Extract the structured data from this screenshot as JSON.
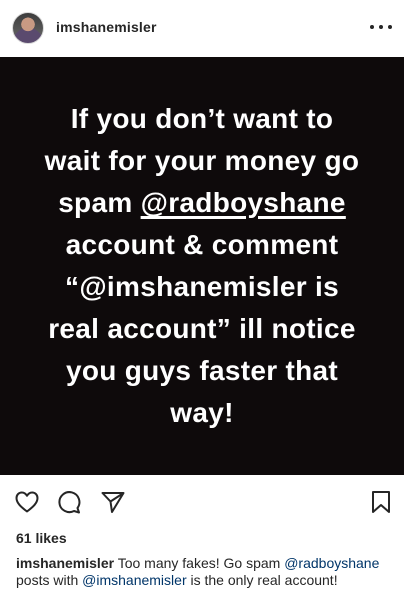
{
  "header": {
    "username": "imshanemisler"
  },
  "media": {
    "line1": "If you don’t want to",
    "line2": "wait for your money go",
    "line3_pre": "spam ",
    "line3_link": "@radboyshane",
    "line4": "account & comment",
    "line5": "“@imshanemisler is",
    "line6": "real account” ill notice",
    "line7": "you guys faster that",
    "line8": "way!"
  },
  "actions": {
    "icons": [
      "heart-icon",
      "comment-icon",
      "share-icon",
      "bookmark-icon"
    ]
  },
  "likes": "61 likes",
  "caption": {
    "username": "imshanemisler",
    "text1": " Too many fakes! Go spam ",
    "mention1": "@radboyshane",
    "text2": " posts with ",
    "mention2": "@imshanemisler",
    "text3": " is the only real account!"
  },
  "colors": {
    "media_bg": "#0e0a0b",
    "mention": "#003569",
    "text": "#262626"
  }
}
